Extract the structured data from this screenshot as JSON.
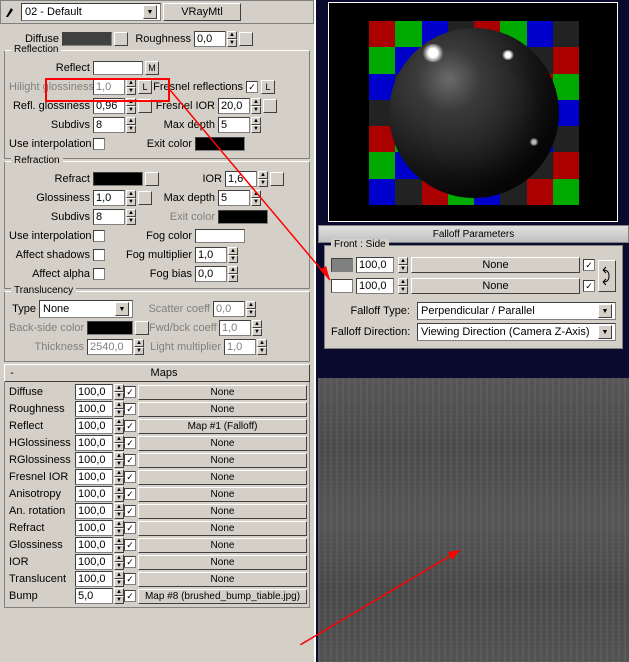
{
  "toolbar": {
    "material_slot": "02 - Default",
    "type_btn": "VRayMtl"
  },
  "diffuse": {
    "label": "Diffuse",
    "roughness_label": "Roughness",
    "roughness": "0,0"
  },
  "reflection": {
    "title": "Reflection",
    "reflect_label": "Reflect",
    "m_btn": "M",
    "hilight_label": "Hilight glossiness",
    "hilight": "1,0",
    "l_btn": "L",
    "fresnel_label": "Fresnel reflections",
    "fresnel_l": "L",
    "refl_gloss_label": "Refl. glossiness",
    "refl_gloss": "0,96",
    "fresnel_ior_label": "Fresnel IOR",
    "fresnel_ior": "20,0",
    "subdivs_label": "Subdivs",
    "subdivs": "8",
    "maxdepth_label": "Max depth",
    "maxdepth": "5",
    "interp_label": "Use interpolation",
    "exit_label": "Exit color"
  },
  "refraction": {
    "title": "Refraction",
    "refract_label": "Refract",
    "ior_label": "IOR",
    "ior": "1,6",
    "gloss_label": "Glossiness",
    "gloss": "1,0",
    "maxdepth_label": "Max depth",
    "maxdepth": "5",
    "subdivs_label": "Subdivs",
    "subdivs": "8",
    "exit_label": "Exit color",
    "interp_label": "Use interpolation",
    "fog_label": "Fog color",
    "shadows_label": "Affect shadows",
    "fogmult_label": "Fog multiplier",
    "fogmult": "1,0",
    "alpha_label": "Affect alpha",
    "fogbias_label": "Fog bias",
    "fogbias": "0,0"
  },
  "translucency": {
    "title": "Translucency",
    "type_label": "Type",
    "type_value": "None",
    "scatter_label": "Scatter coeff",
    "scatter": "0,0",
    "back_label": "Back-side color",
    "fwd_label": "Fwd/bck coeff",
    "fwd": "1,0",
    "thick_label": "Thickness",
    "thick": "2540,0",
    "light_label": "Light multiplier",
    "light": "1,0"
  },
  "maps": {
    "title": "Maps",
    "rows": [
      {
        "label": "Diffuse",
        "amt": "100,0",
        "chk": true,
        "map": "None"
      },
      {
        "label": "Roughness",
        "amt": "100,0",
        "chk": true,
        "map": "None"
      },
      {
        "label": "Reflect",
        "amt": "100,0",
        "chk": true,
        "map": "Map #1  (Falloff)"
      },
      {
        "label": "HGlossiness",
        "amt": "100,0",
        "chk": true,
        "map": "None"
      },
      {
        "label": "RGlossiness",
        "amt": "100,0",
        "chk": true,
        "map": "None"
      },
      {
        "label": "Fresnel IOR",
        "amt": "100,0",
        "chk": true,
        "map": "None"
      },
      {
        "label": "Anisotropy",
        "amt": "100,0",
        "chk": true,
        "map": "None"
      },
      {
        "label": "An. rotation",
        "amt": "100,0",
        "chk": true,
        "map": "None"
      },
      {
        "label": "Refract",
        "amt": "100,0",
        "chk": true,
        "map": "None"
      },
      {
        "label": "Glossiness",
        "amt": "100,0",
        "chk": true,
        "map": "None"
      },
      {
        "label": "IOR",
        "amt": "100,0",
        "chk": true,
        "map": "None"
      },
      {
        "label": "Translucent",
        "amt": "100,0",
        "chk": true,
        "map": "None"
      },
      {
        "label": "Bump",
        "amt": "5,0",
        "chk": true,
        "map": "Map #8 (brushed_bump_tiable.jpg)"
      }
    ]
  },
  "falloff": {
    "panel_title": "Falloff Parameters",
    "group_title": "Front : Side",
    "front_amt": "100,0",
    "front_map": "None",
    "side_amt": "100,0",
    "side_map": "None",
    "type_label": "Falloff Type:",
    "type_value": "Perpendicular / Parallel",
    "dir_label": "Falloff Direction:",
    "dir_value": "Viewing Direction (Camera Z-Axis)"
  },
  "colors": {
    "diffuse": "#404040",
    "reflect": "#ffffff",
    "exit_refl": "#000000",
    "refract": "#000000",
    "exit_refr": "#000000",
    "fog": "#ffffff",
    "back": "#000000",
    "front_swatch": "#808080",
    "side_swatch": "#ffffff"
  },
  "checker_colors": [
    "#a00",
    "#0a0",
    "#00c",
    "#222"
  ]
}
